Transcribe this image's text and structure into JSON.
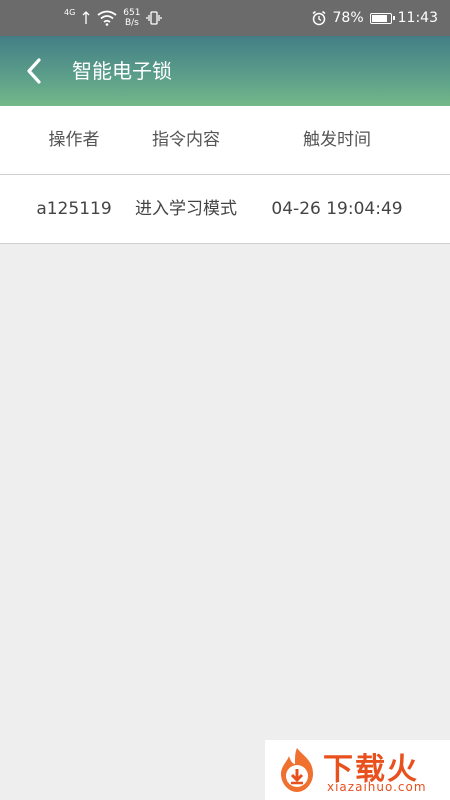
{
  "status_bar": {
    "network": "4G",
    "speed_value": "651",
    "speed_unit": "B/s",
    "battery": "78%",
    "battery_level": 0.78,
    "time": "11:43",
    "icons": [
      "signal-icon",
      "wifi-icon",
      "vibrate-icon",
      "alarm-icon",
      "battery-icon"
    ]
  },
  "header": {
    "back_icon": "chevron-left-icon",
    "title": "智能电子锁"
  },
  "table": {
    "columns": [
      "操作者",
      "指令内容",
      "触发时间"
    ],
    "rows": [
      [
        "a125119",
        "进入学习模式",
        "04-26 19:04:49"
      ]
    ]
  },
  "watermark": {
    "title": "下载火",
    "url": "xiazaihuo.com"
  },
  "colors": {
    "status_bar": "#6b6b6b",
    "header_top": "#437e86",
    "header_bottom": "#72b889",
    "background": "#eeeeee",
    "watermark_accent": "#e8501e"
  }
}
